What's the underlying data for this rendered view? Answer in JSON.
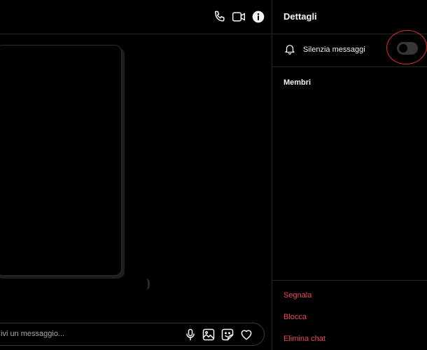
{
  "chat": {
    "header": {
      "icons": [
        "phone-icon",
        "video-camera-icon",
        "info-icon"
      ]
    },
    "composer": {
      "placeholder": "ivi un messaggio...",
      "icons": [
        "microphone-icon",
        "image-icon",
        "sticker-icon",
        "heart-icon"
      ]
    }
  },
  "details": {
    "title": "Dettagli",
    "mute": {
      "label": "Silenzia messaggi",
      "enabled": false
    },
    "members_heading": "Membri",
    "actions": {
      "report": "Segnala",
      "block": "Blocca",
      "delete_chat": "Elimina chat"
    }
  },
  "colors": {
    "background": "#000000",
    "text": "#f5f5f5",
    "danger": "#ed4956",
    "annotation": "#e0302b",
    "divider": "#262626"
  }
}
